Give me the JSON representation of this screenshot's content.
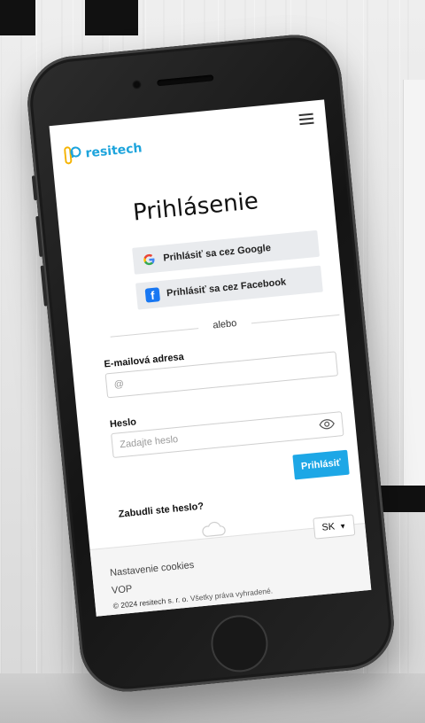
{
  "brand": {
    "name": "resitech",
    "color": "#1da4dc"
  },
  "nav": {
    "menu_icon": "hamburger-menu-icon"
  },
  "login": {
    "title": "Prihlásenie",
    "google_label": "Prihlásiť sa cez Google",
    "facebook_label": "Prihlásiť sa cez Facebook",
    "separator": "alebo",
    "email_label": "E-mailová adresa",
    "email_placeholder": "@",
    "password_label": "Heslo",
    "password_placeholder": "Zadajte heslo",
    "submit_label": "Prihlásiť",
    "forgot_label": "Zabudli ste heslo?"
  },
  "footer": {
    "language": "SK",
    "cookies_label": "Nastavenie cookies",
    "terms_label": "VOP",
    "copyright": "© 2024 resitech s. r. o.",
    "rights": "Všetky práva vyhradené."
  },
  "colors": {
    "accent": "#1da7e6",
    "facebook": "#1877f2"
  }
}
